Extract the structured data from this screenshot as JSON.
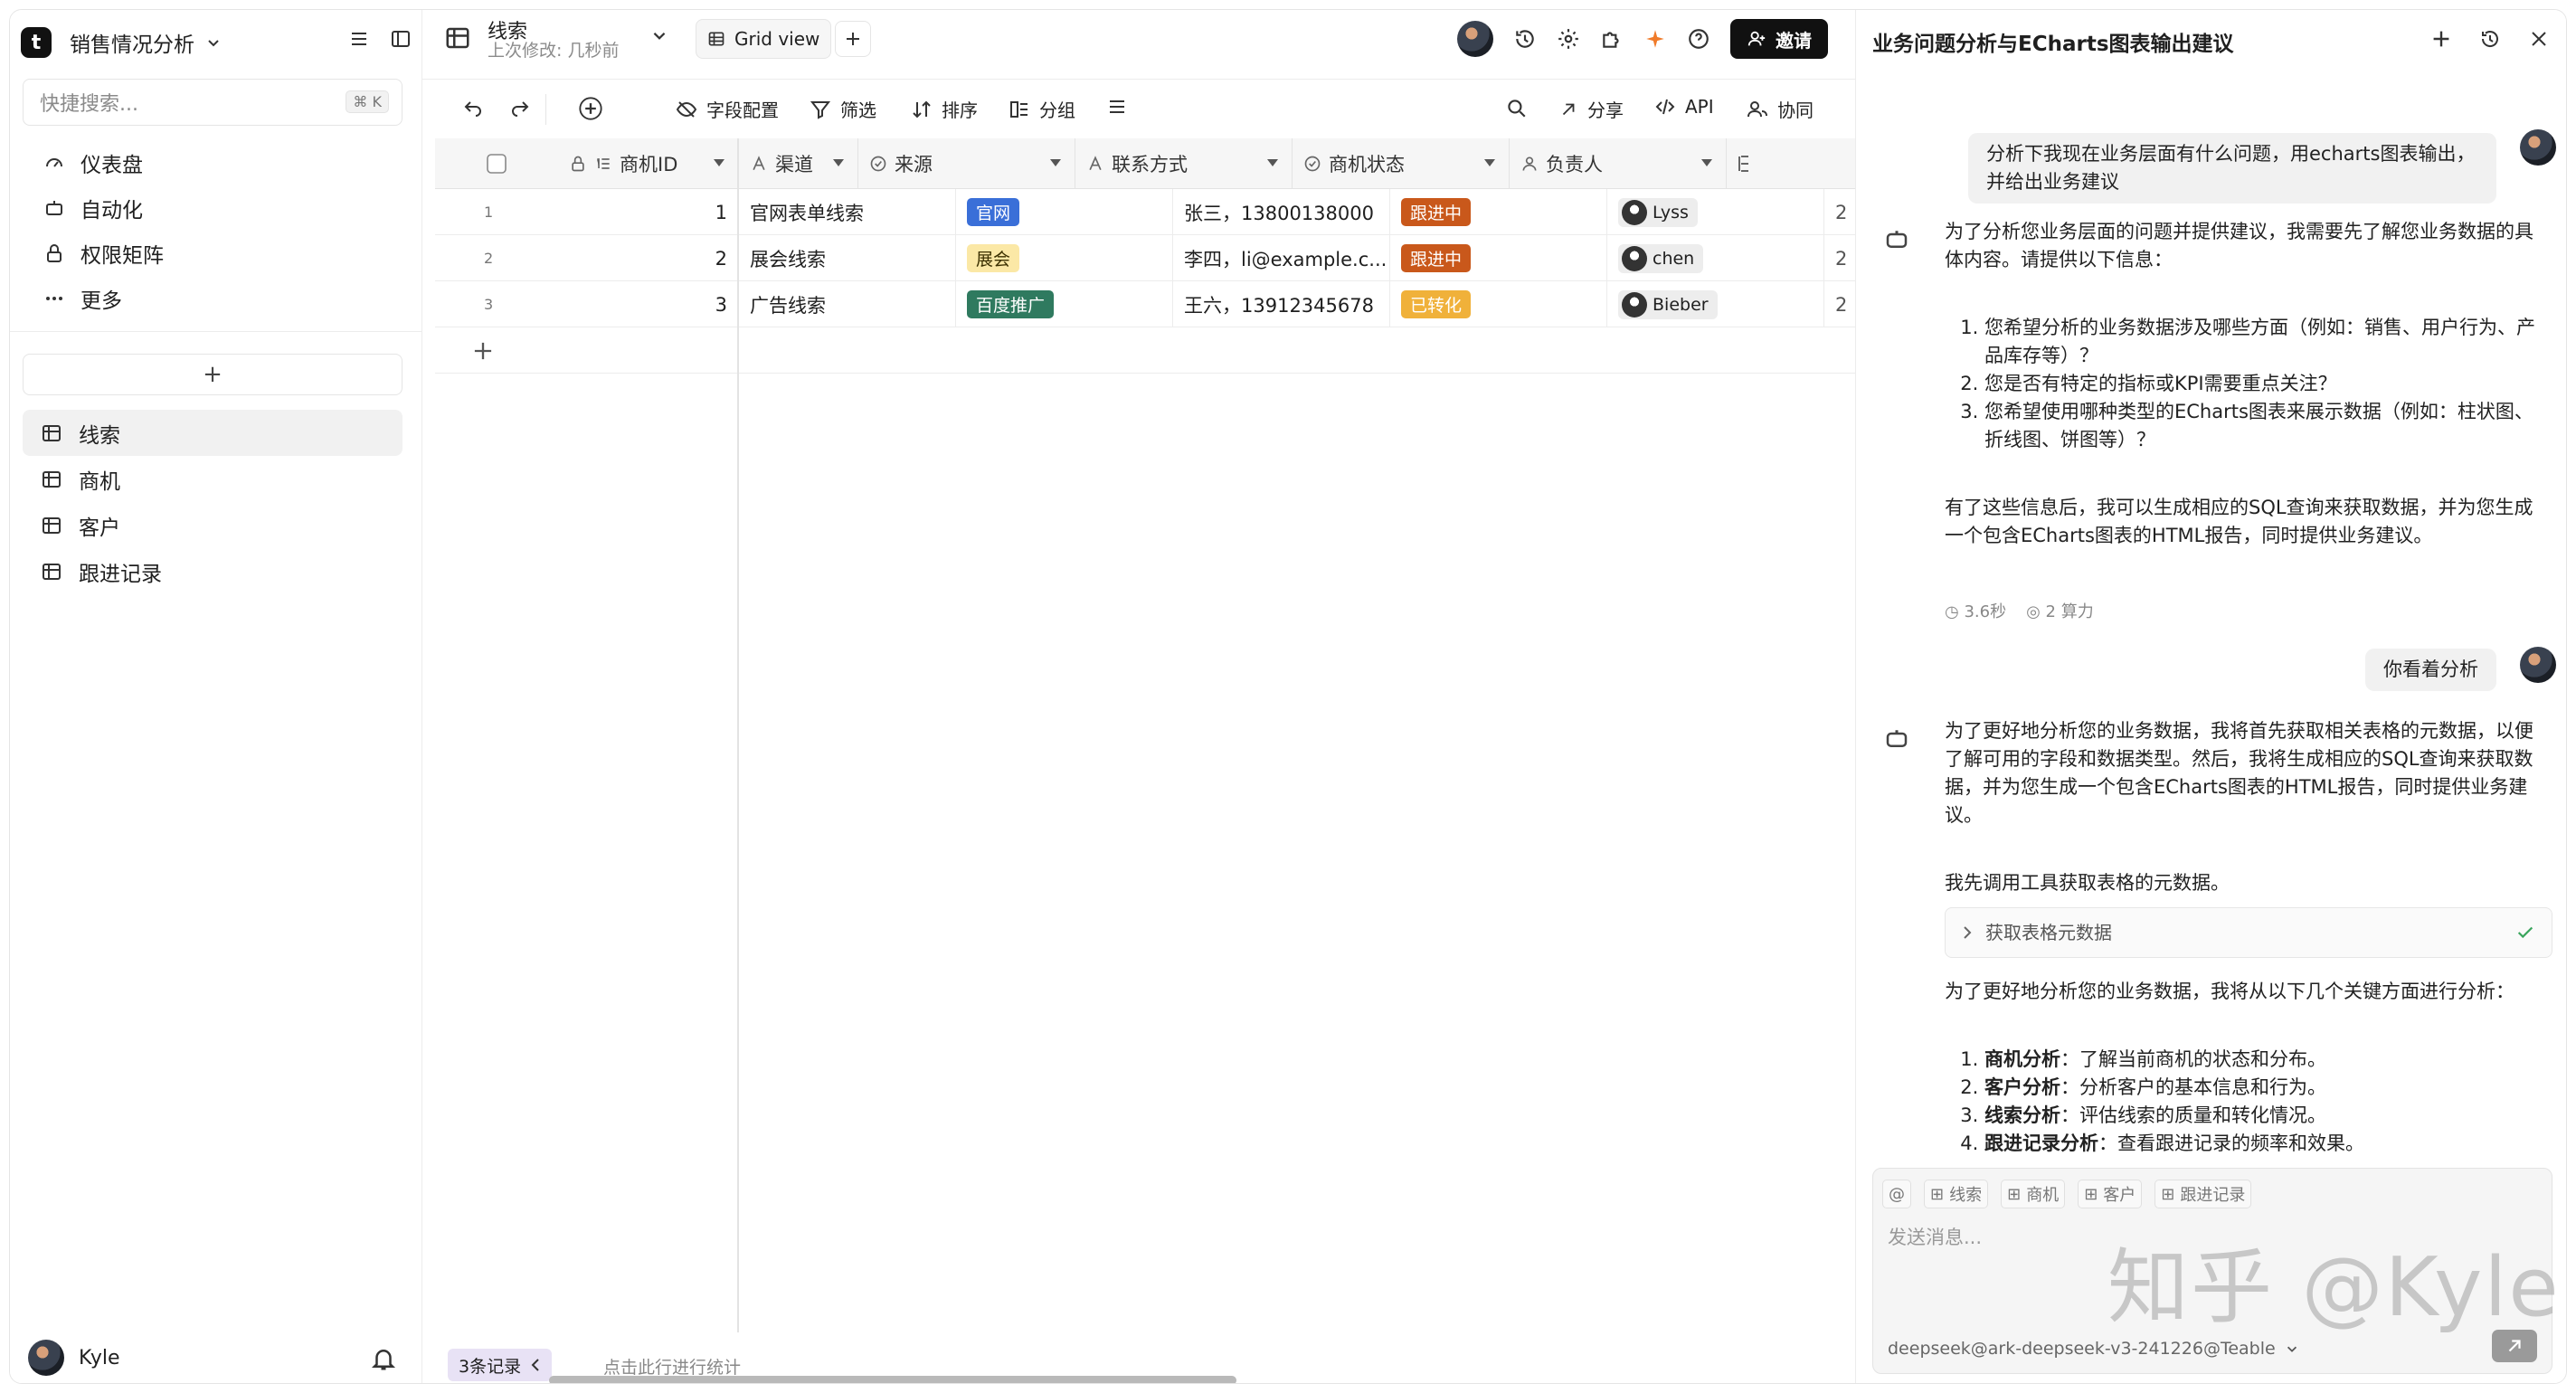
{
  "sidebar": {
    "base_name": "销售情况分析",
    "search_placeholder": "快捷搜索...",
    "search_shortcut": "⌘ K",
    "menu": [
      {
        "label": "仪表盘",
        "icon": "gauge-icon"
      },
      {
        "label": "自动化",
        "icon": "robot-icon"
      },
      {
        "label": "权限矩阵",
        "icon": "lock-icon"
      },
      {
        "label": "更多",
        "icon": "more-icon"
      }
    ],
    "add_label": "+",
    "tables": [
      "线索",
      "商机",
      "客户",
      "跟进记录"
    ],
    "active_table": "线索",
    "user": "Kyle"
  },
  "topbar": {
    "table_name": "线索",
    "last_modified": "上次修改: 几秒前",
    "view_name": "Grid view",
    "invite_label": "邀请"
  },
  "toolbar": {
    "fields": "字段配置",
    "filter": "筛选",
    "sort": "排序",
    "group": "分组",
    "share": "分享",
    "api": "API",
    "collab": "协同"
  },
  "grid": {
    "columns": [
      "商机ID",
      "渠道",
      "来源",
      "联系方式",
      "商机状态",
      "负责人"
    ],
    "rows": [
      {
        "n": "1",
        "id": "1",
        "channel": "官网表单线索",
        "source": "官网",
        "contact": "张三，13800138000",
        "status": "跟进中",
        "owner": "Lyss"
      },
      {
        "n": "2",
        "id": "2",
        "channel": "展会线索",
        "source": "展会",
        "contact": "李四，li@example.c...",
        "status": "跟进中",
        "owner": "chen"
      },
      {
        "n": "3",
        "id": "3",
        "channel": "广告线索",
        "source": "百度推广",
        "contact": "王六，13912345678",
        "status": "已转化",
        "owner": "Bieber"
      }
    ],
    "record_count": "3条记录",
    "stats_hint": "点击此行进行统计"
  },
  "colors": {
    "tag_official": "#3a6fd8",
    "tag_expo": "#fbe8a6",
    "tag_baidu": "#2f7a5f",
    "status_following": "#c9581b",
    "status_converted": "#f0b13a"
  },
  "chat": {
    "title": "业务问题分析与ECharts图表输出建议",
    "user_msg_1": "分析下我现在业务层面有什么问题，用echarts图表输出，并给出业务建议",
    "ai_msg_1_intro": "为了分析您业务层面的问题并提供建议，我需要先了解您业务数据的具体内容。请提供以下信息：",
    "ai_msg_1_list": [
      "您希望分析的业务数据涉及哪些方面（例如：销售、用户行为、产品库存等）？",
      "您是否有特定的指标或KPI需要重点关注？",
      "您希望使用哪种类型的ECharts图表来展示数据（例如：柱状图、折线图、饼图等）？"
    ],
    "ai_msg_1_outro": "有了这些信息后，我可以生成相应的SQL查询来获取数据，并为您生成一个包含ECharts图表的HTML报告，同时提供业务建议。",
    "meta_time": "3.6秒",
    "meta_cost": "2 算力",
    "user_msg_2": "你看着分析",
    "ai_msg_2_p1": "为了更好地分析您的业务数据，我将首先获取相关表格的元数据，以便了解可用的字段和数据类型。然后，我将生成相应的SQL查询来获取数据，并为您生成一个包含ECharts图表的HTML报告，同时提供业务建议。",
    "ai_msg_2_p2": "我先调用工具获取表格的元数据。",
    "tool_label": "获取表格元数据",
    "ai_msg_2_p3": "为了更好地分析您的业务数据，我将从以下几个关键方面进行分析：",
    "ai_msg_2_list": [
      {
        "b": "商机分析",
        "t": "：了解当前商机的状态和分布。"
      },
      {
        "b": "客户分析",
        "t": "：分析客户的基本信息和行为。"
      },
      {
        "b": "线索分析",
        "t": "：评估线索的质量和转化情况。"
      },
      {
        "b": "跟进记录分析",
        "t": "：查看跟进记录的频率和效果。"
      }
    ],
    "mentions": [
      "@",
      "线索",
      "商机",
      "客户",
      "跟进记录"
    ],
    "input_placeholder": "发送消息...",
    "model": "deepseek@ark-deepseek-v3-241226@Teable"
  },
  "watermark": "知乎 @Kyle"
}
